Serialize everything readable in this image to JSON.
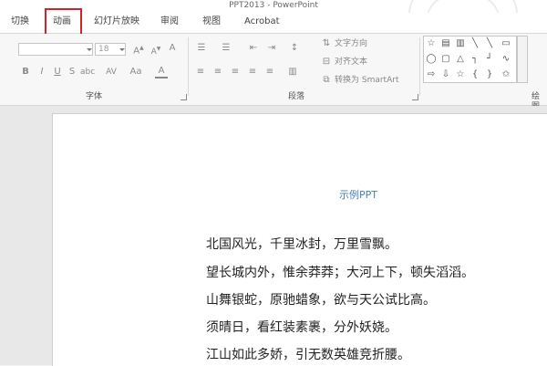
{
  "window": {
    "title": "PPT2013 - PowerPoint"
  },
  "tabs": [
    {
      "label": "切换"
    },
    {
      "label": "动画"
    },
    {
      "label": "幻灯片放映"
    },
    {
      "label": "审阅"
    },
    {
      "label": "视图"
    },
    {
      "label": "Acrobat"
    }
  ],
  "ribbon": {
    "font": {
      "size_value": "18",
      "group_label": "字体"
    },
    "paragraph": {
      "text_direction": "文字方向",
      "align_text": "对齐文本",
      "convert_smartart": "转换为 SmartArt",
      "group_label": "段落"
    },
    "drawing": {
      "group_label": "绘图"
    }
  },
  "slide": {
    "title": "示例PPT",
    "lines": [
      "北国风光，千里冰封，万里雪飘。",
      "望长城内外，惟余莽莽；大河上下，顿失滔滔。",
      "山舞银蛇，原驰蜡象，欲与天公试比高。",
      "须晴日，看红装素裹，分外妖娆。",
      "江山如此多娇，引无数英雄竞折腰。"
    ]
  },
  "colors": {
    "highlight": "#d2232a",
    "slide_title": "#4a7fb5"
  }
}
